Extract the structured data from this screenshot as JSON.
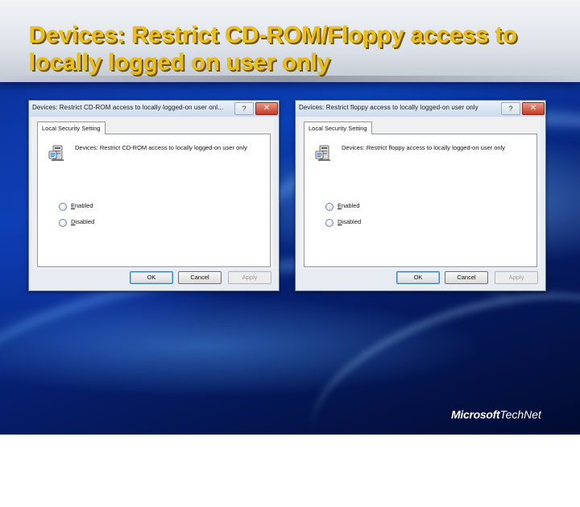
{
  "slide": {
    "title": "Devices: Restrict CD-ROM/Floppy access to locally logged on user only"
  },
  "dialogs": [
    {
      "title": "Devices: Restrict CD-ROM access to locally logged-on user onl...",
      "help_glyph": "?",
      "close_glyph": "✕",
      "tab_label": "Local Security Setting",
      "policy_icon": "policy-server-icon",
      "policy_text": "Devices: Restrict CD-ROM access to locally logged-on user only",
      "options": [
        {
          "accel": "E",
          "rest": "nabled"
        },
        {
          "accel": "D",
          "rest": "isabled"
        }
      ],
      "buttons": {
        "ok": "OK",
        "cancel": "Cancel",
        "apply": "Apply"
      }
    },
    {
      "title": "Devices: Restrict floppy access to locally logged-on user only",
      "help_glyph": "?",
      "close_glyph": "✕",
      "tab_label": "Local Security Setting",
      "policy_icon": "policy-server-icon",
      "policy_text": "Devices: Restrict floppy access to locally logged-on user only",
      "options": [
        {
          "accel": "E",
          "rest": "nabled"
        },
        {
          "accel": "D",
          "rest": "isabled"
        }
      ],
      "buttons": {
        "ok": "OK",
        "cancel": "Cancel",
        "apply": "Apply"
      }
    }
  ],
  "logo": {
    "brand": "Microsoft",
    "product": "TechNet"
  },
  "colors": {
    "title_text": "#f0c000",
    "title_band": "#dfe3ea",
    "background": "#0b3fb5"
  }
}
